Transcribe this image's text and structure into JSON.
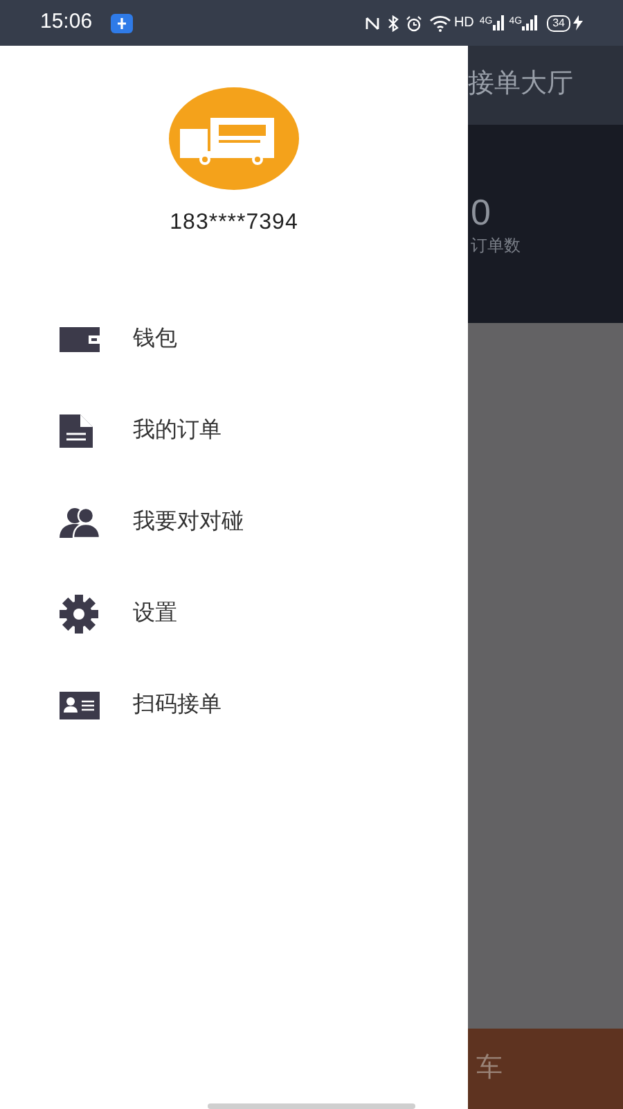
{
  "status_bar": {
    "time": "15:06",
    "hd": "HD",
    "network_1": "4G",
    "network_2": "4G",
    "battery": "34"
  },
  "drawer": {
    "phone": "183****7394",
    "menu": [
      {
        "kind": "wallet",
        "label": "钱包"
      },
      {
        "kind": "document",
        "label": "我的订单"
      },
      {
        "kind": "people",
        "label": "我要对对碰"
      },
      {
        "kind": "gear",
        "label": "设置"
      },
      {
        "kind": "card",
        "label": "扫码接单"
      }
    ]
  },
  "main": {
    "title": "接单大厅",
    "count": "0",
    "count_label": "订单数",
    "bottom_button": "车"
  }
}
